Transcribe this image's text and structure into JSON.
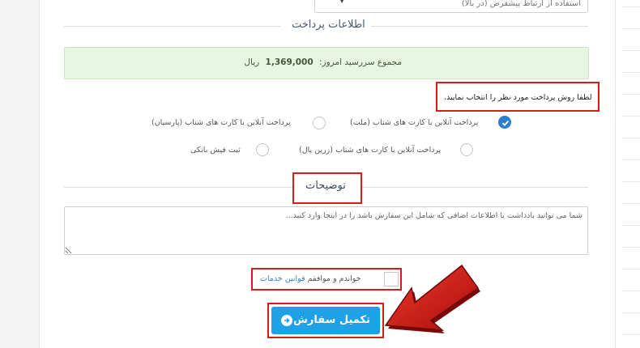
{
  "contact_select": {
    "value": "استفاده از ارتباط پیشفرض (در بالا)"
  },
  "payment_section": {
    "title": "اطلاعات پرداخت"
  },
  "total_due": {
    "label": "مجموع سررسید امروز:",
    "amount": "1,369,000",
    "currency": "ریال"
  },
  "payment_note": "لطفا روش پرداخت مورد نظر را انتخاب نمایید.",
  "payment_methods": [
    {
      "label": "پرداخت آنلاین با کارت های شتاب (ملت)",
      "selected": true
    },
    {
      "label": "پرداخت آنلاین با کارت های شتاب (پارسیان)",
      "selected": false
    },
    {
      "label": "پرداخت آنلاین با کارت های شتاب (زرین پال)",
      "selected": false
    },
    {
      "label": "ثبت فیش بانکی",
      "selected": false
    }
  ],
  "description_section": {
    "title": "توضیحات",
    "placeholder": "شما می توانید یادداشت یا اطلاعات اضافی که شامل این سفارش باشد را در اینجا وارد کنید..."
  },
  "terms": {
    "text": "خواندم و موافقم",
    "link": "قوانین خدمات"
  },
  "submit": {
    "label": "تکمیل سفارش"
  },
  "colors": {
    "accent": "#1ea1e6",
    "highlight": "#d41e1e",
    "radio_selected": "#2f7ecb",
    "success_bg": "#e8f5e1"
  }
}
